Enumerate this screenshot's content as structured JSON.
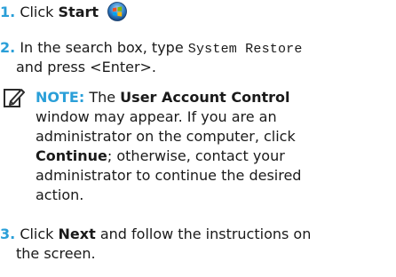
{
  "steps": [
    {
      "number": "1.",
      "pre": "Click ",
      "bold": "Start",
      "icon": "windows-start-orb-icon"
    },
    {
      "number": "2.",
      "pre": "In the search box, type ",
      "code": "System Restore",
      "cont": "and press <Enter>."
    },
    {
      "number": "3.",
      "pre": "Click ",
      "bold": "Next",
      "post": " and follow the instructions on",
      "cont": "the screen."
    }
  ],
  "note": {
    "icon": "pencil-note-icon",
    "label": "NOTE:",
    "text_1": " The ",
    "bold_1": "User Account Control",
    "line_2": "window may appear. If you are an",
    "line_3": "administrator on the computer, click",
    "bold_2": "Continue",
    "text_2": "; otherwise, contact your",
    "line_5": "administrator to continue the desired",
    "line_6": "action."
  },
  "colors": {
    "accent": "#2a9fd8",
    "text": "#1a1a1a"
  }
}
